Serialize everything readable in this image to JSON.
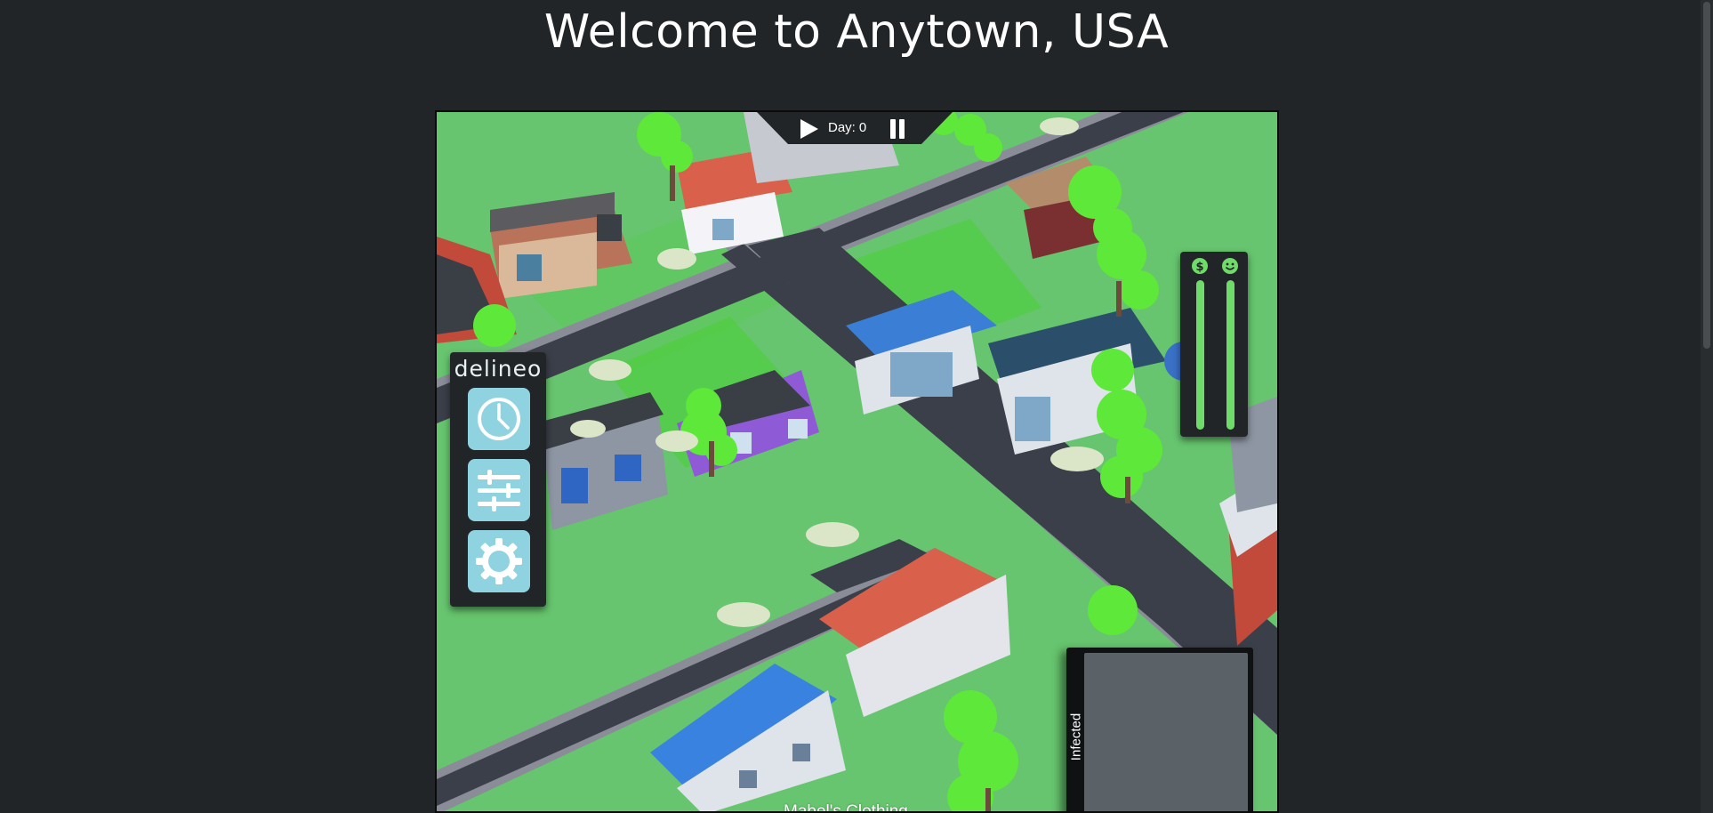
{
  "page": {
    "title": "Welcome to Anytown, USA"
  },
  "game": {
    "top_controls": {
      "day_label": "Day:",
      "day_value": "0",
      "play_icon": "play-icon",
      "pause_icon": "pause-icon"
    },
    "side_menu": {
      "logo_text": "delineo",
      "buttons": [
        {
          "icon": "clock-icon"
        },
        {
          "icon": "sliders-icon"
        },
        {
          "icon": "gear-icon"
        }
      ]
    },
    "sliders": {
      "money_icon": "dollar-icon",
      "happiness_icon": "smiley-icon"
    },
    "infected_panel": {
      "label": "Infected"
    },
    "building_label": "Mabel's Clothing"
  },
  "colors": {
    "background": "#222527",
    "grass": "#66c56e",
    "road": "#3b3f49",
    "button_accent": "#8fd3e0",
    "slider_green": "#6fdc6a"
  }
}
